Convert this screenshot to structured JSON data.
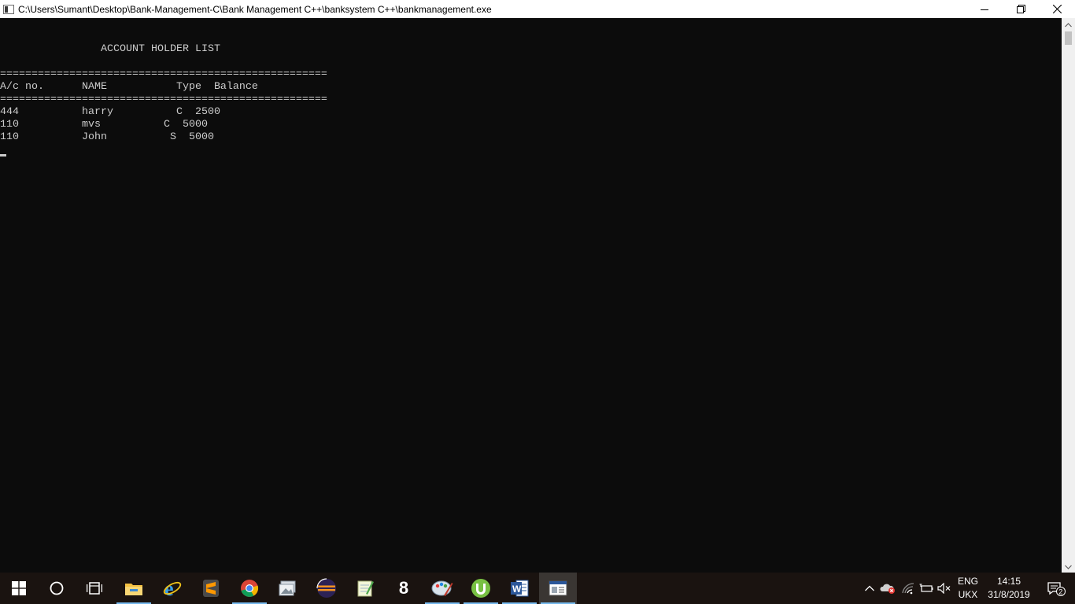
{
  "window": {
    "title": "C:\\Users\\Sumant\\Desktop\\Bank-Management-C\\Bank Management C++\\banksystem C++\\bankmanagement.exe"
  },
  "console": {
    "heading": "                ACCOUNT HOLDER LIST",
    "separator": "====================================================",
    "header": "A/c no.      NAME           Type  Balance",
    "rows": [
      "444          harry          C  2500",
      "110          mvs          C  5000",
      "110          John          S  5000"
    ]
  },
  "taskbar": {
    "apps": [
      "start-icon",
      "cortana-icon",
      "task-view-icon",
      "file-explorer-icon",
      "internet-explorer-icon",
      "sublime-text-icon",
      "chrome-icon",
      "image-viewer-icon",
      "eclipse-icon",
      "notepad-icon",
      "app-8-icon",
      "paint-icon",
      "utorrent-icon",
      "word-icon",
      "console-app-icon"
    ],
    "tray": {
      "language": "ENG",
      "keyboard": "UKX",
      "time": "14:15",
      "date": "31/8/2019",
      "notifications_count": "2"
    }
  },
  "colors": {
    "console_bg": "#0c0c0c",
    "console_fg": "#cccccc",
    "taskbar_bg": "#1a1310",
    "accent": "#76b9ed"
  }
}
